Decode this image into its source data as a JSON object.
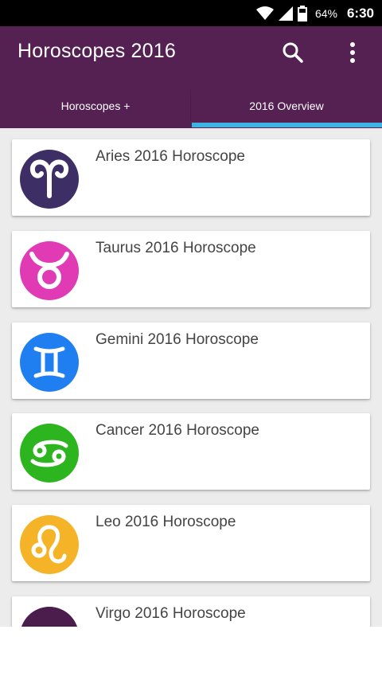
{
  "status_bar": {
    "battery": "64%",
    "time": "6:30",
    "icons": [
      "wifi-icon",
      "signal-icon",
      "battery-icon"
    ]
  },
  "app_bar": {
    "title": "Horoscopes 2016",
    "background_color": "#542152",
    "actions": [
      "search-icon",
      "more-vert-icon"
    ]
  },
  "tabs": [
    {
      "label": "Horoscopes +",
      "selected": false
    },
    {
      "label": "2016 Overview",
      "selected": true
    }
  ],
  "accent_color": "#3fb2e4",
  "list": [
    {
      "title": "Aries 2016 Horoscope",
      "icon": "aries-icon",
      "color": "#3d2f66"
    },
    {
      "title": "Taurus 2016 Horoscope",
      "icon": "taurus-icon",
      "color": "#e03ab5"
    },
    {
      "title": "Gemini 2016 Horoscope",
      "icon": "gemini-icon",
      "color": "#1f7ff0"
    },
    {
      "title": "Cancer 2016 Horoscope",
      "icon": "cancer-icon",
      "color": "#2cb51f"
    },
    {
      "title": "Leo 2016 Horoscope",
      "icon": "leo-icon",
      "color": "#f5b327"
    },
    {
      "title": "Virgo 2016 Horoscope",
      "icon": "virgo-icon",
      "color": "#4b1d4d"
    }
  ]
}
